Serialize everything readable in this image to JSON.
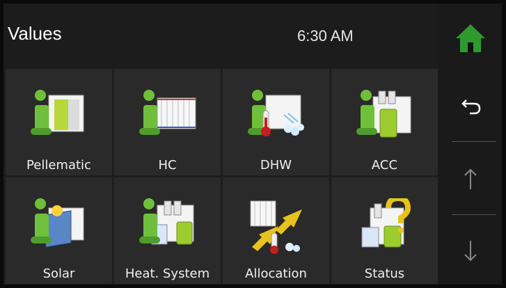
{
  "header": {
    "title": "Values",
    "time": "6:30 AM"
  },
  "sidebar": {
    "home_icon": "home-icon",
    "back_icon": "back-arrow-icon",
    "up_icon": "arrow-up-icon",
    "down_icon": "arrow-down-icon",
    "colors": {
      "home": "#2e9a2e"
    }
  },
  "tiles": [
    {
      "label": "Pellematic",
      "icon": "pellematic-icon"
    },
    {
      "label": "HC",
      "icon": "heating-circuit-icon"
    },
    {
      "label": "DHW",
      "icon": "hot-water-icon"
    },
    {
      "label": "ACC",
      "icon": "accumulator-icon"
    },
    {
      "label": "Solar",
      "icon": "solar-icon"
    },
    {
      "label": "Heat. System",
      "icon": "heat-system-icon"
    },
    {
      "label": "Allocation",
      "icon": "allocation-icon"
    },
    {
      "label": "Status",
      "icon": "status-icon"
    }
  ]
}
